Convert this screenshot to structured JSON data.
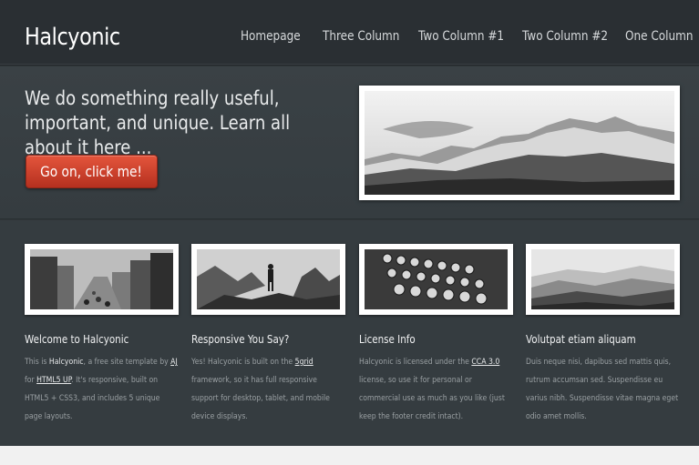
{
  "header": {
    "logo": "Halcyonic",
    "nav": [
      "Homepage",
      "Three Column",
      "Two Column #1",
      "Two Column #2",
      "One Column"
    ]
  },
  "banner": {
    "headline": "We do something really useful, important, and unique. Learn all about it here ...",
    "cta_label": "Go on, click me!",
    "photo_icon": "mountain-panorama-photo"
  },
  "features": [
    {
      "title": "Welcome to Halcyonic",
      "text_parts": [
        "This is ",
        "Halcyonic",
        ", a free site template by ",
        "AJ",
        " for ",
        "HTML5 UP",
        ". It's responsive, built on HTML5 + CSS3, and includes 5 unique page layouts."
      ],
      "photo_icon": "city-street-photo"
    },
    {
      "title": "Responsive You Say?",
      "text_parts": [
        "Yes! Halcyonic is built on the ",
        "5grid",
        " framework, so it has full responsive support for desktop, tablet, and mobile device displays."
      ],
      "photo_icon": "hiker-photo"
    },
    {
      "title": "License Info",
      "text_parts": [
        "Halcyonic is licensed under the ",
        "CCA 3.0",
        " license, so use it for personal or commercial use as much as you like (just keep the footer credit intact)."
      ],
      "photo_icon": "typewriter-photo"
    },
    {
      "title": "Volutpat etiam aliquam",
      "text_parts": [
        "Duis neque nisi, dapibus sed mattis quis, rutrum accumsan sed. Suspendisse eu varius nibh. Suspendisse vitae magna eget odio amet mollis."
      ],
      "photo_icon": "hills-landscape-photo"
    }
  ]
}
